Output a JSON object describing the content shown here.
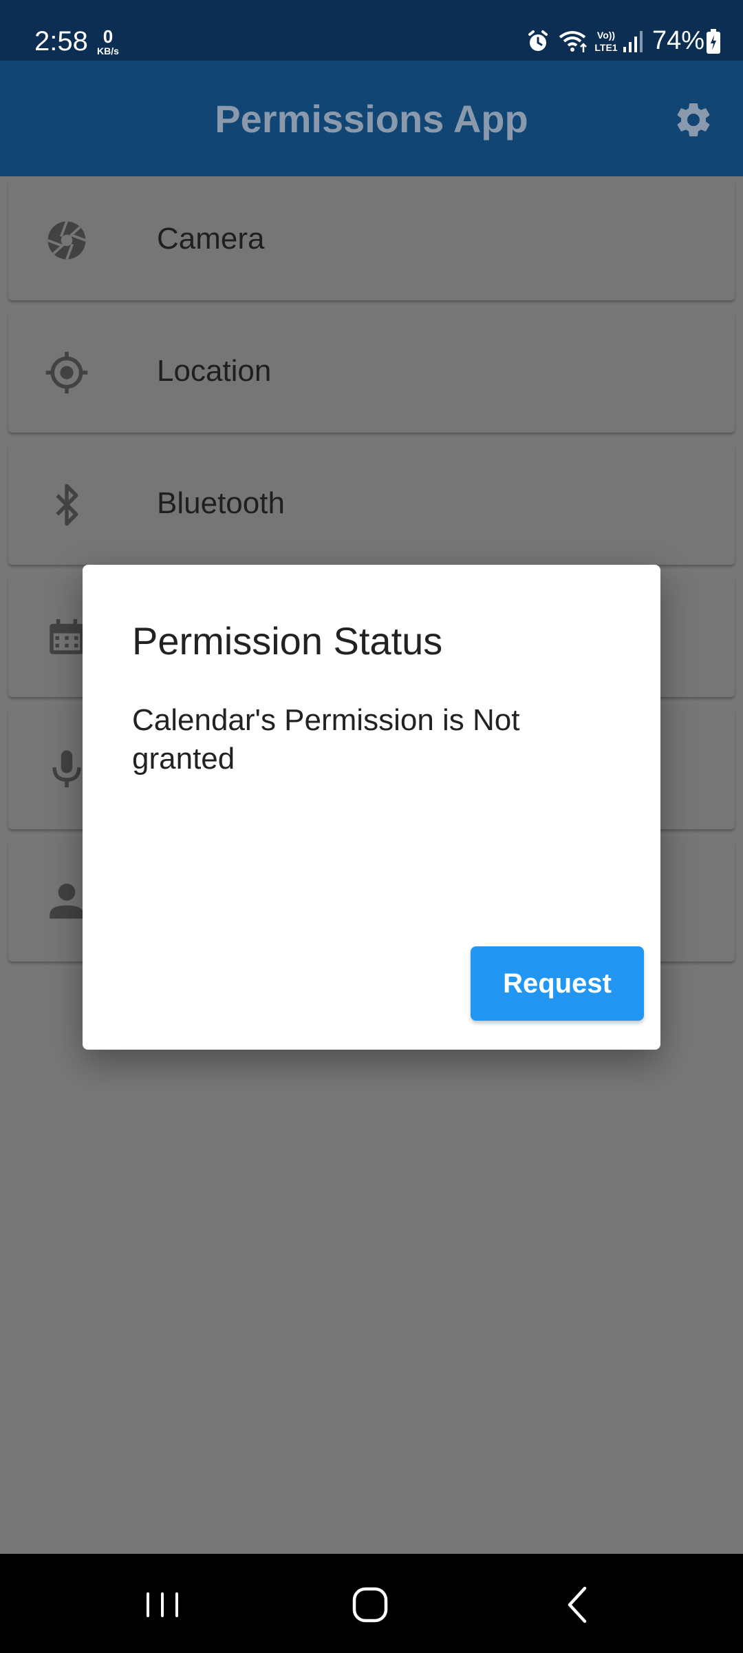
{
  "status_bar": {
    "time": "2:58",
    "network_speed_value": "0",
    "network_speed_unit": "KB/s",
    "network_type": "Vo) LTE1",
    "battery_percent": "74%",
    "icons": [
      "alarm-icon",
      "wifi-icon",
      "lte-icon",
      "signal-icon",
      "battery-icon"
    ]
  },
  "app_bar": {
    "title": "Permissions App",
    "settings_icon": "gear-icon"
  },
  "permissions": [
    {
      "label": "Camera",
      "icon": "camera-aperture-icon"
    },
    {
      "label": "Location",
      "icon": "location-crosshair-icon"
    },
    {
      "label": "Bluetooth",
      "icon": "bluetooth-icon"
    },
    {
      "label": "",
      "icon": "calendar-icon"
    },
    {
      "label": "",
      "icon": "microphone-icon"
    },
    {
      "label": "",
      "icon": "person-icon"
    }
  ],
  "dialog": {
    "title": "Permission Status",
    "message": "Calendar's Permission is Not granted",
    "request_label": "Request"
  },
  "nav_bar": {
    "icons": [
      "recent-apps-icon",
      "home-icon",
      "back-icon"
    ]
  },
  "colors": {
    "status_bar": "#0c2e52",
    "app_bar": "#114573",
    "scrim_background": "#777777",
    "dialog_background": "#ffffff",
    "button_accent": "#2196f3",
    "nav_bar": "#000000"
  }
}
